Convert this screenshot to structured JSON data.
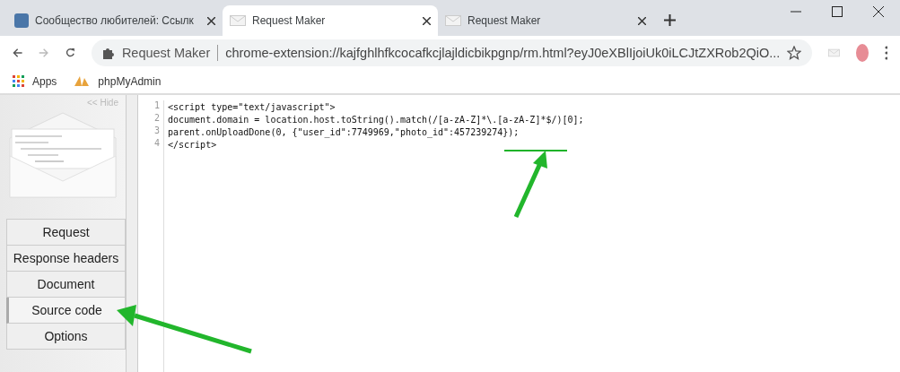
{
  "tabs": [
    {
      "kind": "vk",
      "title": "Сообщество любителей: Ссылк",
      "selected": false
    },
    {
      "kind": "rm",
      "title": "Request Maker",
      "selected": true
    },
    {
      "kind": "rm",
      "title": "Request Maker",
      "selected": false
    }
  ],
  "address_bar": {
    "site_label": "Request Maker",
    "url": "chrome-extension://kajfghlhfkcocafkcjlajldicbikpgnp/rm.html?eyJ0eXBlIjoiUk0iLCJtZXRob2QiO..."
  },
  "bookmarks": [
    {
      "kind": "apps",
      "label": "Apps"
    },
    {
      "kind": "pma",
      "label": "phpMyAdmin"
    }
  ],
  "sidebar": {
    "hide_link": "<< Hide",
    "items": [
      {
        "label": "Request",
        "selected": false
      },
      {
        "label": "Response headers",
        "selected": false
      },
      {
        "label": "Document",
        "selected": false
      },
      {
        "label": "Source code",
        "selected": true
      },
      {
        "label": "Options",
        "selected": false
      }
    ]
  },
  "code": {
    "lines": [
      {
        "number": "1",
        "text": "<script type=\"text/javascript\">"
      },
      {
        "number": "2",
        "text": "document.domain = location.host.toString().match(/[a-zA-Z]*\\.[a-zA-Z]*$/)[0];"
      },
      {
        "number": "3",
        "text": "parent.onUploadDone(0, {\"user_id\":7749969,\"photo_id\":457239274});"
      },
      {
        "number": "4",
        "text": "</script>"
      }
    ]
  }
}
